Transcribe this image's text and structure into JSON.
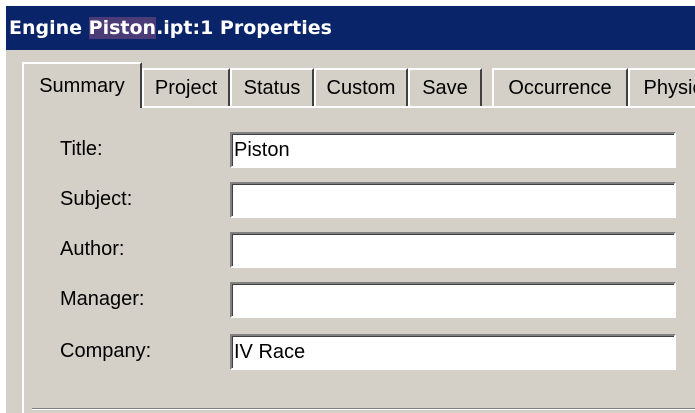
{
  "window": {
    "title_prefix": "Engine ",
    "title_highlight": "Piston",
    "title_suffix": ".ipt:1 Properties"
  },
  "tabs": [
    {
      "label": "Summary",
      "active": true
    },
    {
      "label": "Project",
      "active": false
    },
    {
      "label": "Status",
      "active": false
    },
    {
      "label": "Custom",
      "active": false
    },
    {
      "label": "Save",
      "active": false
    },
    {
      "label": "Occurrence",
      "active": false
    },
    {
      "label": "Physic",
      "active": false
    }
  ],
  "fields": [
    {
      "label": "Title:",
      "value": "Piston"
    },
    {
      "label": "Subject:",
      "value": ""
    },
    {
      "label": "Author:",
      "value": ""
    },
    {
      "label": "Manager:",
      "value": ""
    },
    {
      "label": "Company:",
      "value": "IV Race"
    }
  ],
  "colors": {
    "titlebar": "#0a246a",
    "face": "#d4d0c8",
    "field": "#ffffff"
  }
}
